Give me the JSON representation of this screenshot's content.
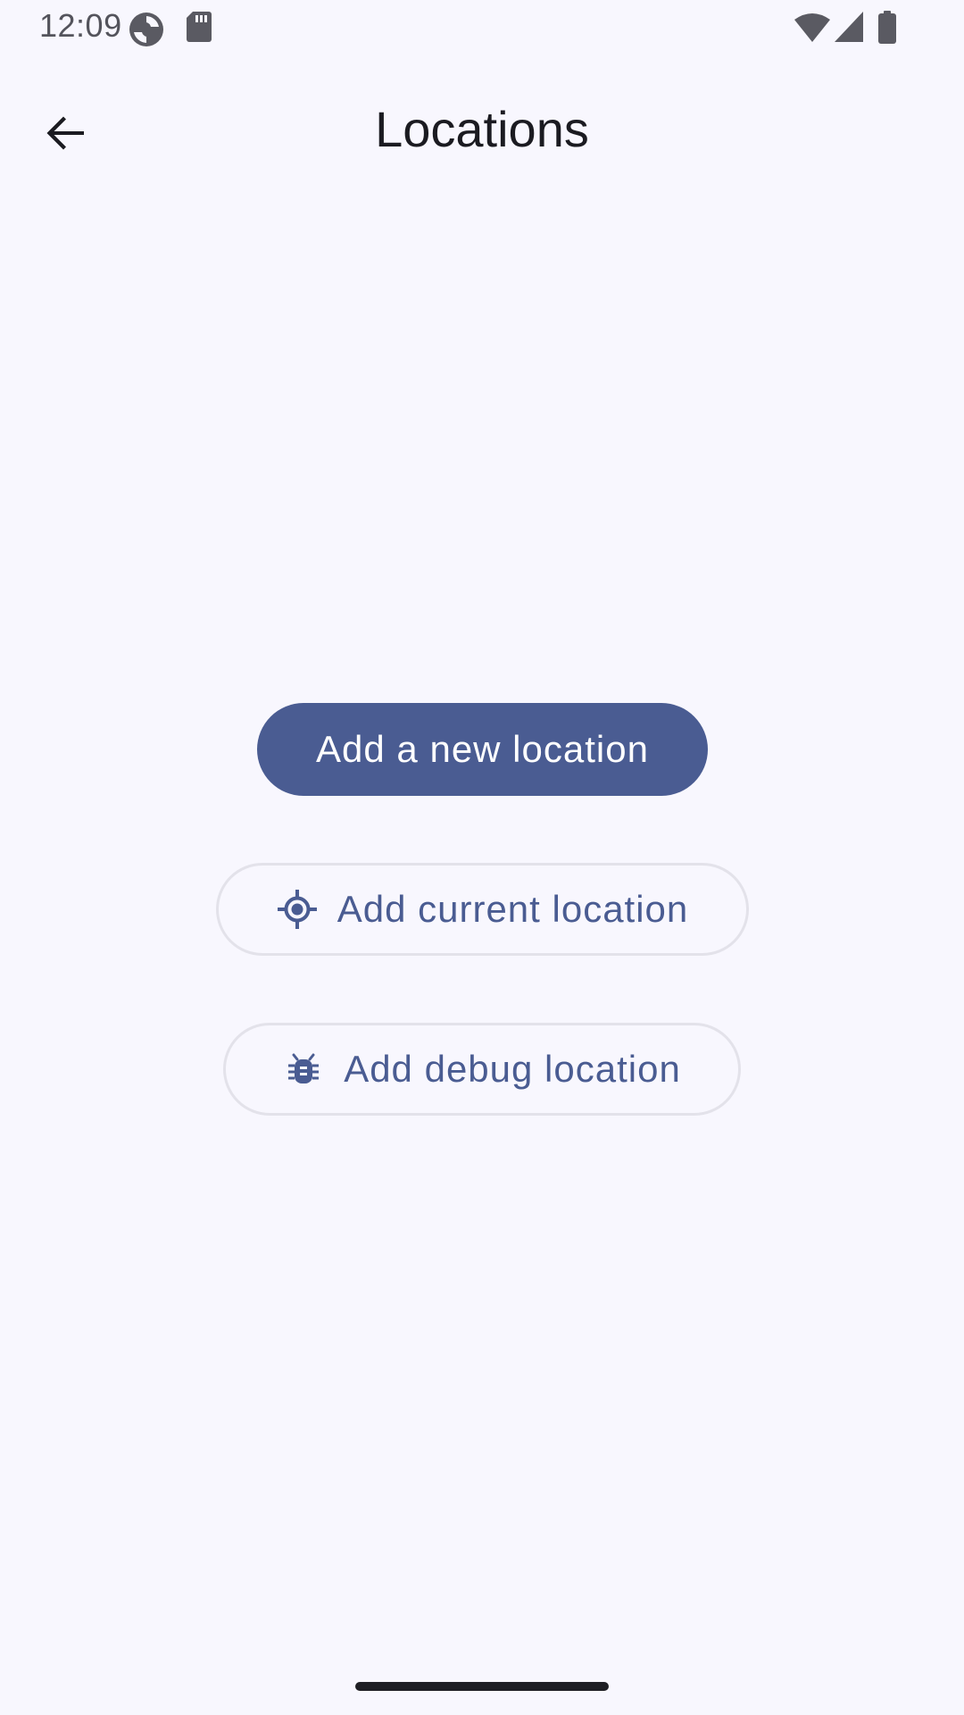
{
  "status_bar": {
    "time": "12:09",
    "left_icons": [
      "sync-icon",
      "sd-card-icon"
    ],
    "right_icons": [
      "wifi-icon",
      "cell-signal-icon",
      "battery-icon"
    ]
  },
  "app_bar": {
    "title": "Locations",
    "back_icon": "arrow-back-icon"
  },
  "actions": {
    "add_new_label": "Add a new location",
    "add_current_label": "Add current location",
    "add_current_icon": "my-location-icon",
    "add_debug_label": "Add debug location",
    "add_debug_icon": "bug-icon"
  },
  "colors": {
    "background": "#F8F7FE",
    "primary": "#4A5C92",
    "on_primary": "#FFFFFF",
    "outline": "#E3E2EA",
    "title": "#1B1B21"
  }
}
